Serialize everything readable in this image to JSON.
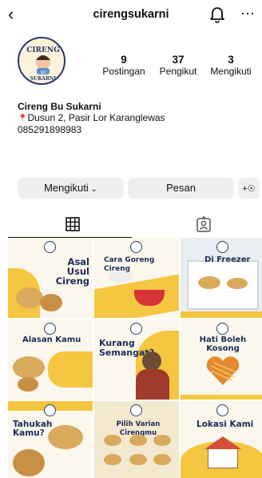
{
  "header": {
    "back_glyph": "‹",
    "username": "cirengsukarni",
    "more_glyph": "⋯"
  },
  "avatar": {
    "logo_top": "CIRENG",
    "logo_bottom": "SUKARNI",
    "logo_small": "IBU"
  },
  "stats": [
    {
      "value": "9",
      "label": "Postingan"
    },
    {
      "value": "37",
      "label": "Pengikut"
    },
    {
      "value": "3",
      "label": "Mengikuti"
    }
  ],
  "bio": {
    "name": "Cireng Bu Sukarni",
    "location_pin": "📍",
    "location": "Dusun 2, Pasir Lor Karanglewas",
    "phone": "085291898983"
  },
  "buttons": {
    "following": "Mengikuti",
    "message": "Pesan",
    "add_user": "+"
  },
  "posts": [
    {
      "title": "Asal Usul Cireng"
    },
    {
      "title": "Cara Goreng Cireng"
    },
    {
      "title": "Di Freezer"
    },
    {
      "title": "Alasan Kamu"
    },
    {
      "title": "Kurang Semangat?"
    },
    {
      "title": "Hati Boleh Kosong"
    },
    {
      "title": "Tahukah Kamu?"
    },
    {
      "title": "Pilih Varian Cirengmu"
    },
    {
      "title": "Lokasi Kami"
    }
  ]
}
